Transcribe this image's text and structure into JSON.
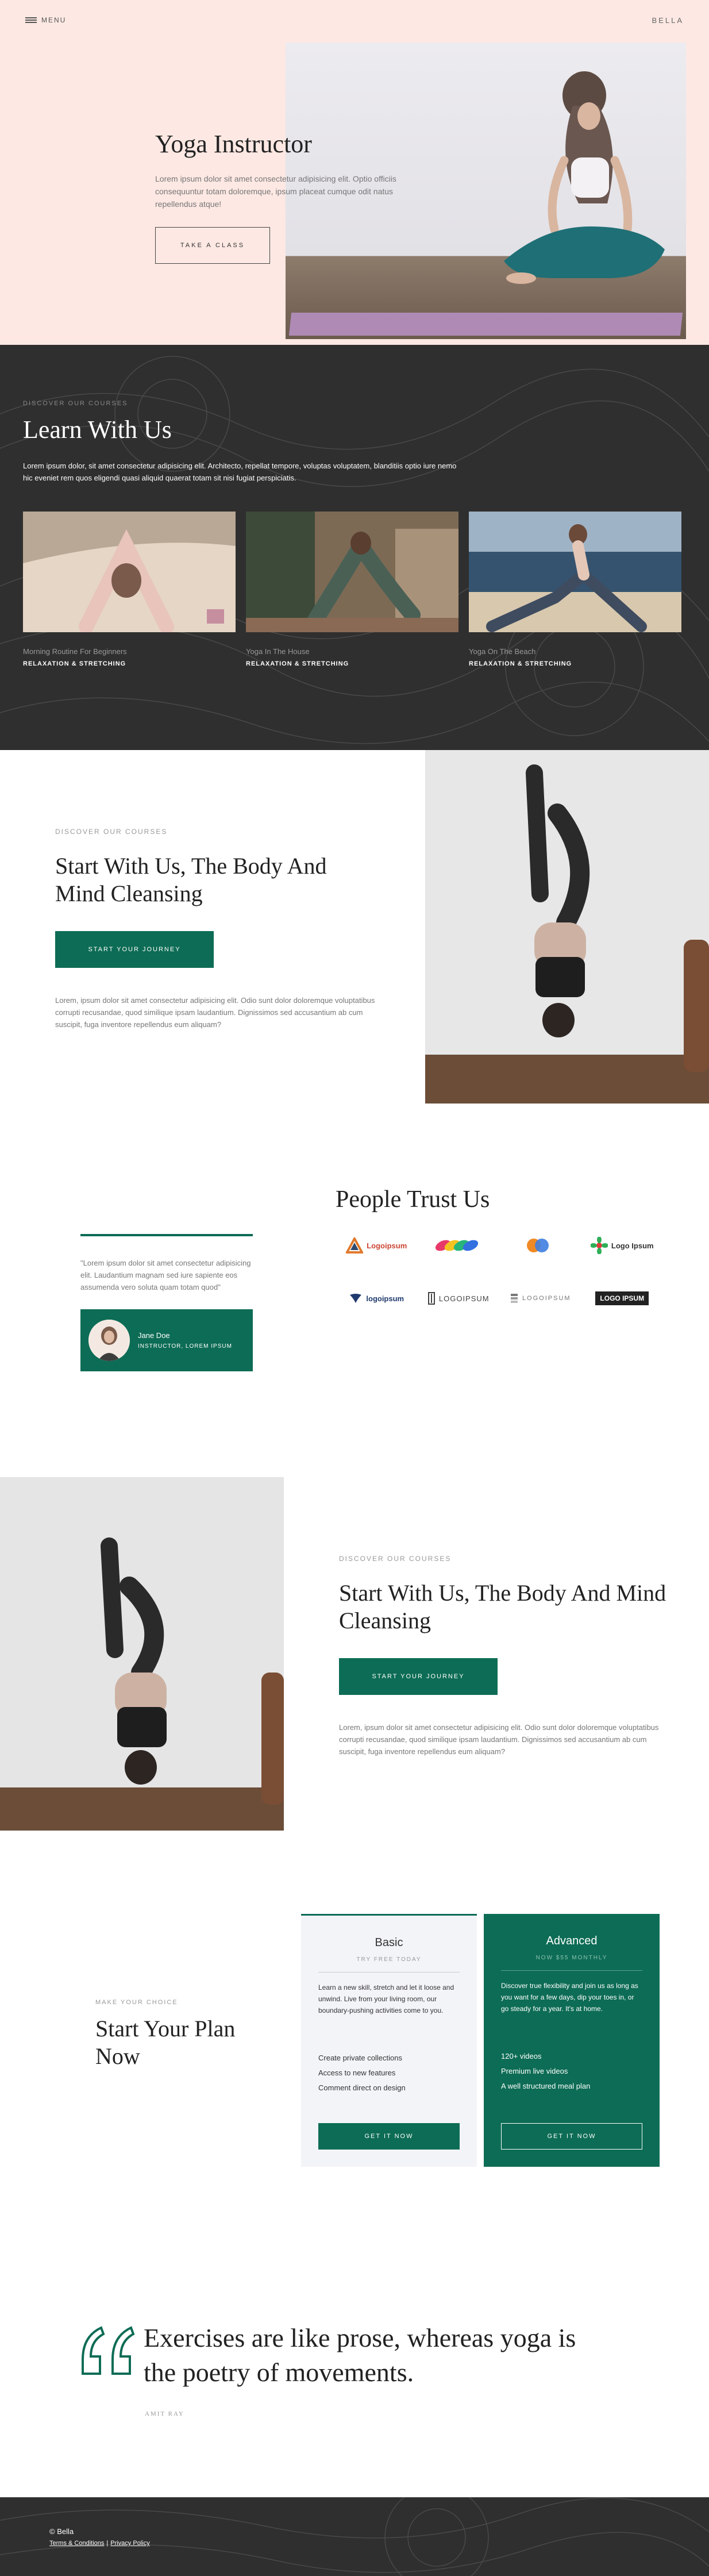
{
  "header": {
    "menu_label": "MENU",
    "brand": "BELLA"
  },
  "hero": {
    "title": "Yoga Instructor",
    "lead": "Lorem ipsum dolor sit amet consectetur adipisicing elit. Optio officiis consequuntur totam doloremque, ipsum placeat cumque odit natus repellendus atque!",
    "button": "TAKE A CLASS"
  },
  "courses": {
    "eyebrow": "DISCOVER OUR COURSES",
    "title": "Learn With Us",
    "description": "Lorem ipsum dolor, sit amet consectetur adipisicing elit. Architecto, repellat tempore, voluptas voluptatem, blanditiis optio iure nemo hic eveniet rem quos eligendi quasi aliquid quaerat totam sit nisi fugiat perspiciatis.",
    "items": [
      {
        "title": "Morning Routine For Beginners",
        "tag": "RELAXATION & STRETCHING"
      },
      {
        "title": "Yoga In The House",
        "tag": "RELAXATION & STRETCHING"
      },
      {
        "title": "Yoga On The Beach",
        "tag": "RELAXATION & STRETCHING"
      }
    ]
  },
  "start1": {
    "eyebrow": "DISCOVER OUR COURSES",
    "title": "Start With Us, The Body And Mind Cleansing",
    "button": "START YOUR JOURNEY",
    "body": "Lorem, ipsum dolor sit amet consectetur adipisicing elit. Odio sunt dolor doloremque voluptatibus corrupti recusandae, quod similique ipsam laudantium. Dignissimos sed accusantium ab cum suscipit, fuga inventore repellendus eum aliquam?"
  },
  "trust": {
    "title": "People Trust Us",
    "quote": "\"Lorem ipsum dolor sit amet consectetur adipisicing elit. Laudantium magnam sed iure sapiente eos assumenda vero soluta quam totam quod\"",
    "person_name": "Jane Doe",
    "person_role": "INSTRUCTOR, LOREM IPSUM",
    "logos": [
      {
        "text": "Logoipsum",
        "icon": "triangle-logo-icon"
      },
      {
        "text": "",
        "icon": "rainbow-leaves-logo-icon"
      },
      {
        "text": "",
        "icon": "overlapping-circles-logo-icon"
      },
      {
        "text": "Logo Ipsum",
        "icon": "flower-logo-icon"
      },
      {
        "text": "logoipsum",
        "icon": "bird-logo-icon"
      },
      {
        "text": "LOGOIPSUM",
        "icon": "column-logo-icon"
      },
      {
        "text": "LOGOIPSUM",
        "icon": "stack-logo-icon"
      },
      {
        "text": "LOGO IPSUM",
        "icon": "box-logo-icon"
      }
    ]
  },
  "start2": {
    "eyebrow": "DISCOVER OUR COURSES",
    "title": "Start With Us, The Body And Mind Cleansing",
    "button": "START YOUR JOURNEY",
    "body": "Lorem, ipsum dolor sit amet consectetur adipisicing elit. Odio sunt dolor doloremque voluptatibus corrupti recusandae, quod similique ipsam laudantium. Dignissimos sed accusantium ab cum suscipit, fuga inventore repellendus eum aliquam?"
  },
  "plan": {
    "eyebrow": "MAKE YOUR CHOICE",
    "title": "Start Your Plan Now",
    "basic": {
      "name": "Basic",
      "sub": "TRY FREE TODAY",
      "desc": "Learn a new skill, stretch and let it loose and unwind. Live from your living room, our boundary-pushing activities come to you.",
      "features": [
        "Create private collections",
        "Access to new features",
        "Comment direct on design"
      ],
      "button": "GET IT NOW"
    },
    "advanced": {
      "name": "Advanced",
      "sub": "NOW $55 MONTHLY",
      "desc": "Discover true flexibility and join us as long as you want for a few days, dip your toes in, or go steady for a year. It's at home.",
      "features": [
        "120+ videos",
        "Premium live videos",
        "A well structured meal plan"
      ],
      "button": "GET IT NOW"
    }
  },
  "quote": {
    "text": "Exercises are like prose, whereas yoga is the poetry of movements.",
    "author": "AMIT RAY"
  },
  "footer": {
    "copyright": "© Bella",
    "terms": "Terms & Conditions",
    "privacy": "Privacy Policy"
  },
  "colors": {
    "accent": "#0d6c55",
    "hero_bg": "#fde8e3",
    "dark": "#2f2f2f"
  }
}
